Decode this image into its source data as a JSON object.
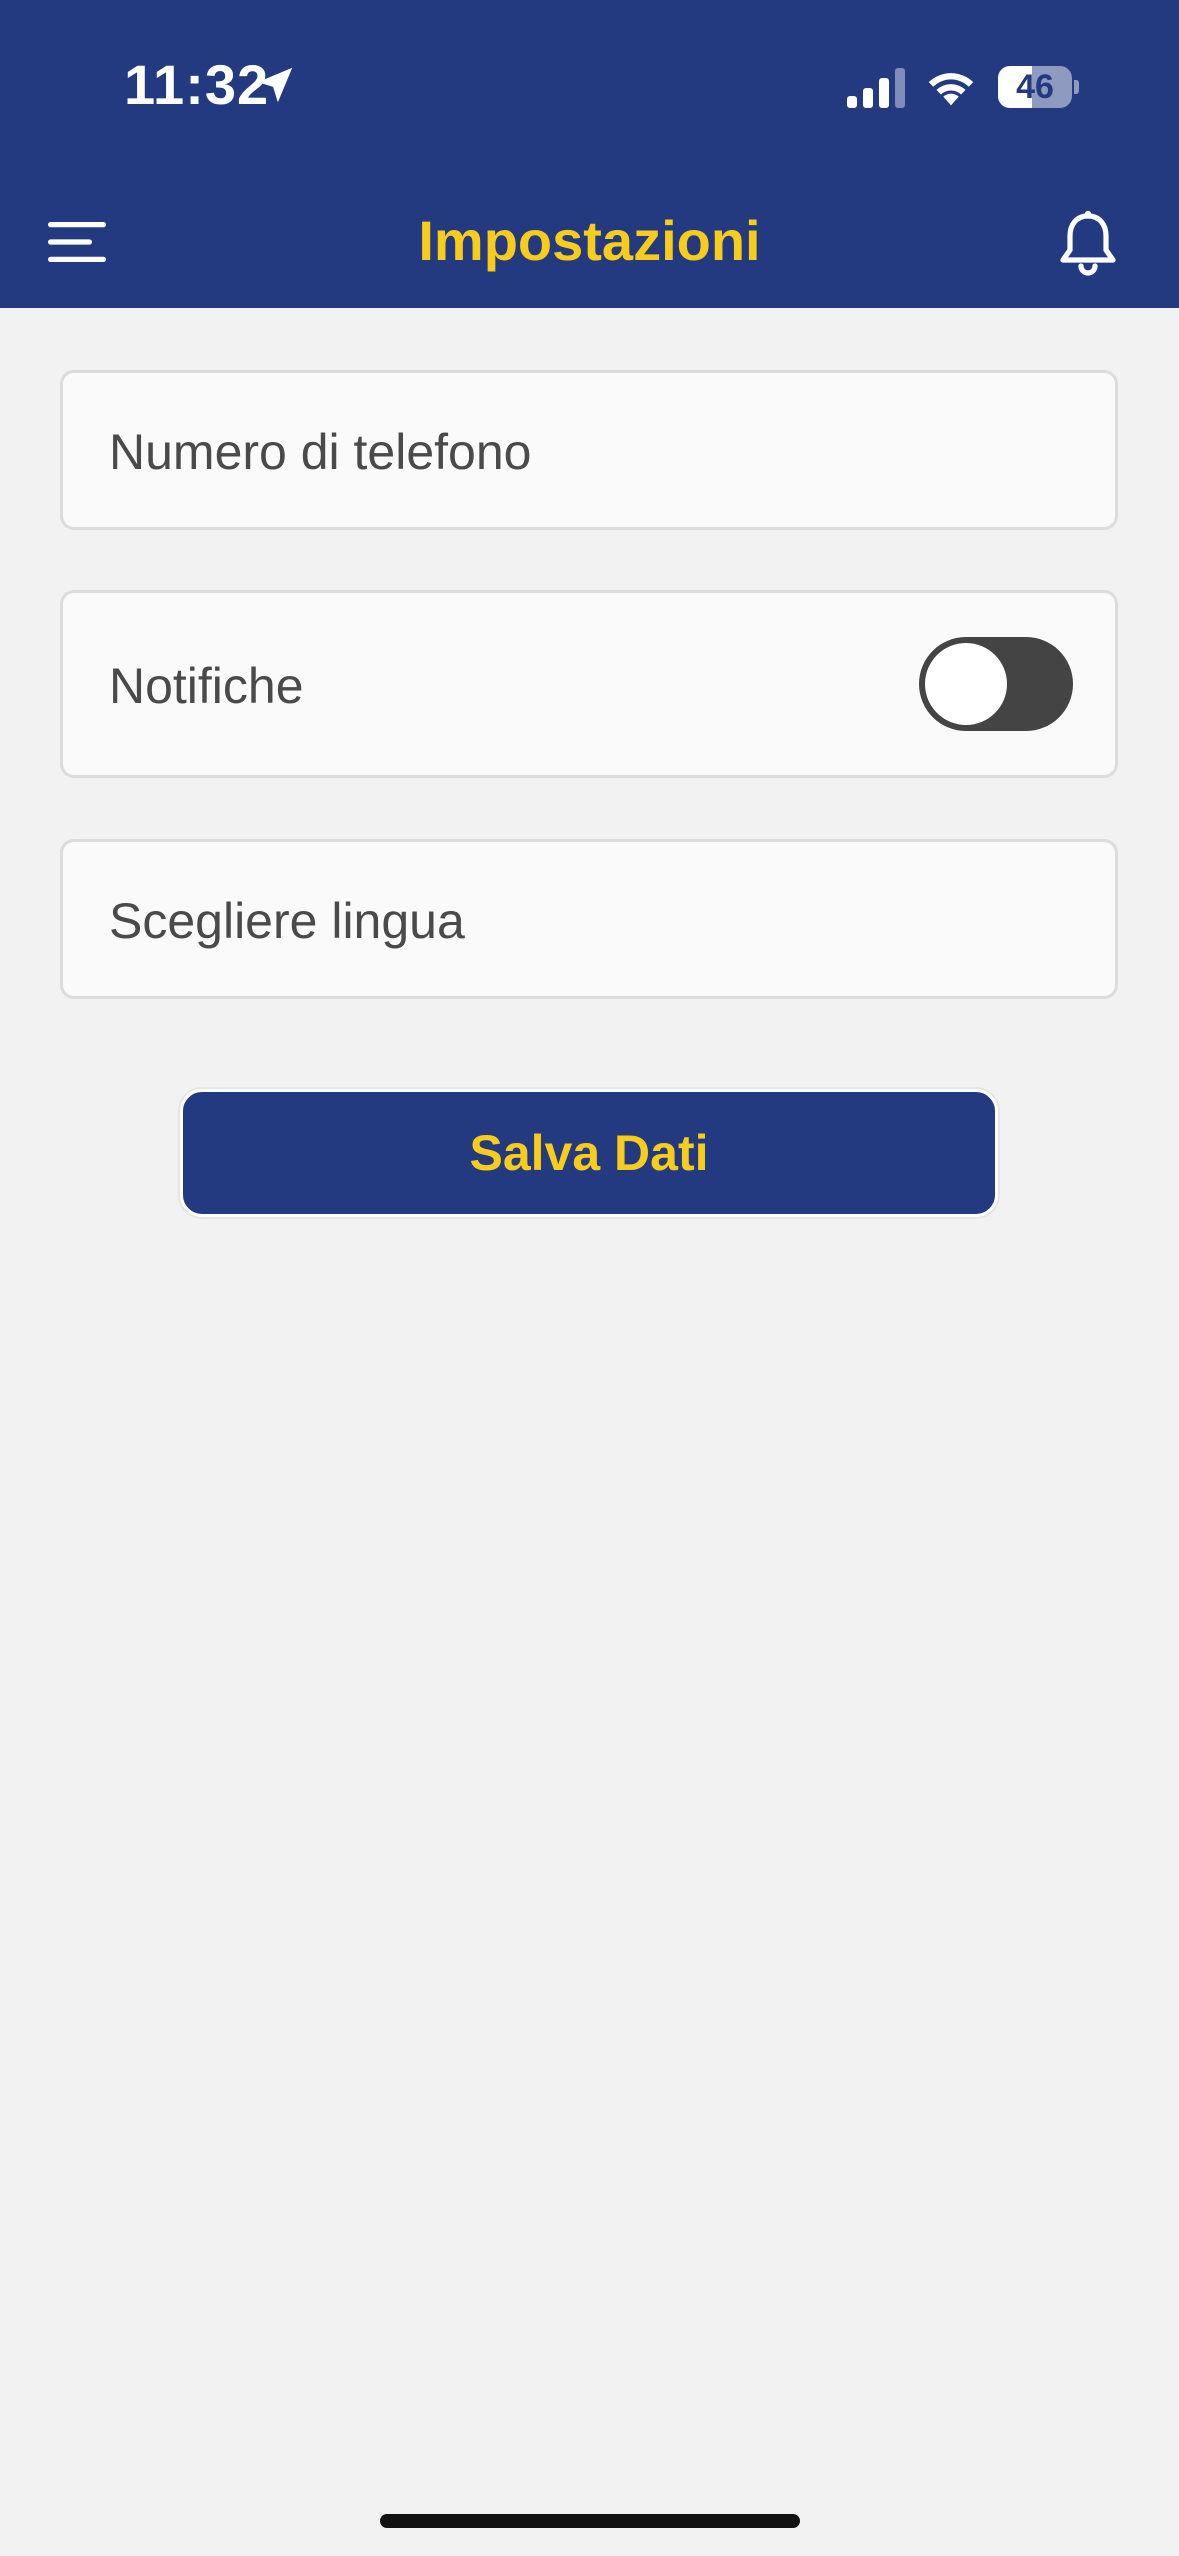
{
  "status_bar": {
    "time": "11:32",
    "battery_level": "46",
    "battery_fraction": 0.46,
    "icons": [
      "location-arrow-icon",
      "signal-icon",
      "wifi-icon",
      "battery-icon"
    ]
  },
  "header": {
    "title": "Impostazioni",
    "left_icon": "menu-icon",
    "right_icon": "bell-icon"
  },
  "form": {
    "phone_placeholder": "Numero di telefono",
    "notifications_label": "Notifiche",
    "notifications_enabled": false,
    "language_placeholder": "Scegliere lingua"
  },
  "actions": {
    "save_label": "Salva Dati"
  },
  "colors": {
    "primary": "#243a80",
    "accent": "#f7cc1a",
    "background": "#f2f2f2",
    "toggle_track": "#444444"
  }
}
